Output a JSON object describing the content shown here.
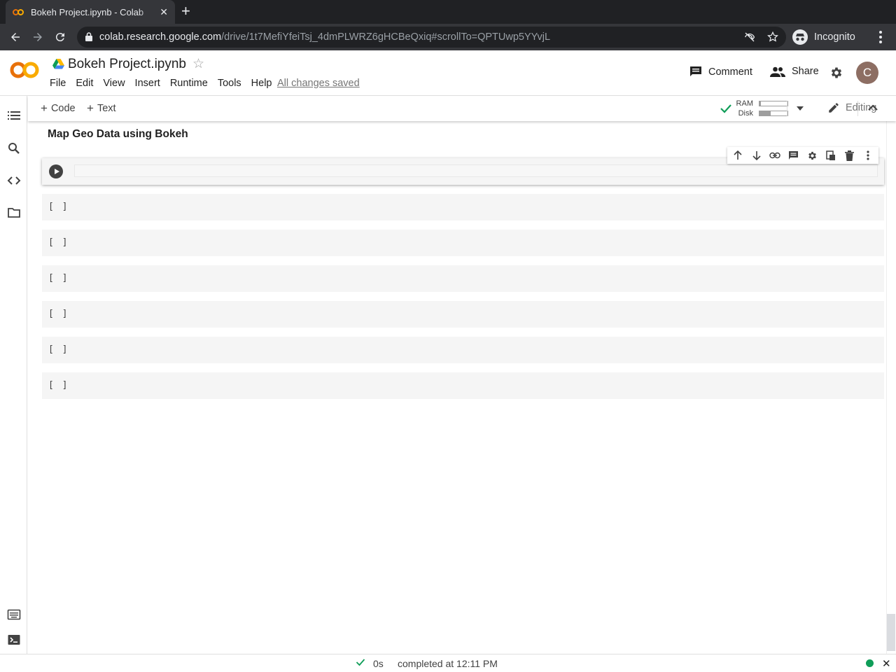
{
  "browser": {
    "tab_title": "Bokeh Project.ipynb - Colab",
    "tab_close": "✕",
    "new_tab": "+",
    "url_host": "colab.research.google.com",
    "url_path": "/drive/1t7MefiYfeiTsj_4dmPLWRZ6gHCBeQxiq#scrollTo=QPTUwp5YYvjL",
    "profile_label": "Incognito"
  },
  "header": {
    "notebook_title": "Bokeh Project.ipynb",
    "star": "☆",
    "menu": [
      "File",
      "Edit",
      "View",
      "Insert",
      "Runtime",
      "Tools",
      "Help"
    ],
    "save_status": "All changes saved",
    "comment_label": "Comment",
    "share_label": "Share",
    "avatar_letter": "C"
  },
  "cell_toolbar": {
    "add_code_label": "Code",
    "add_text_label": "Text",
    "ram_label": "RAM",
    "disk_label": "Disk",
    "ram_usage_percent": 5,
    "disk_usage_percent": 40,
    "editing_label": "Editing"
  },
  "notebook": {
    "section_title": "Map Geo Data using Bokeh",
    "empty_cells": [
      "[ ]",
      "[ ]",
      "[ ]",
      "[ ]",
      "[ ]",
      "[ ]"
    ]
  },
  "status": {
    "duration": "0s",
    "message": "completed at 12:11 PM",
    "close": "✕"
  },
  "colors": {
    "brand_orange": "#f9ab00",
    "status_green": "#0f9d58"
  }
}
